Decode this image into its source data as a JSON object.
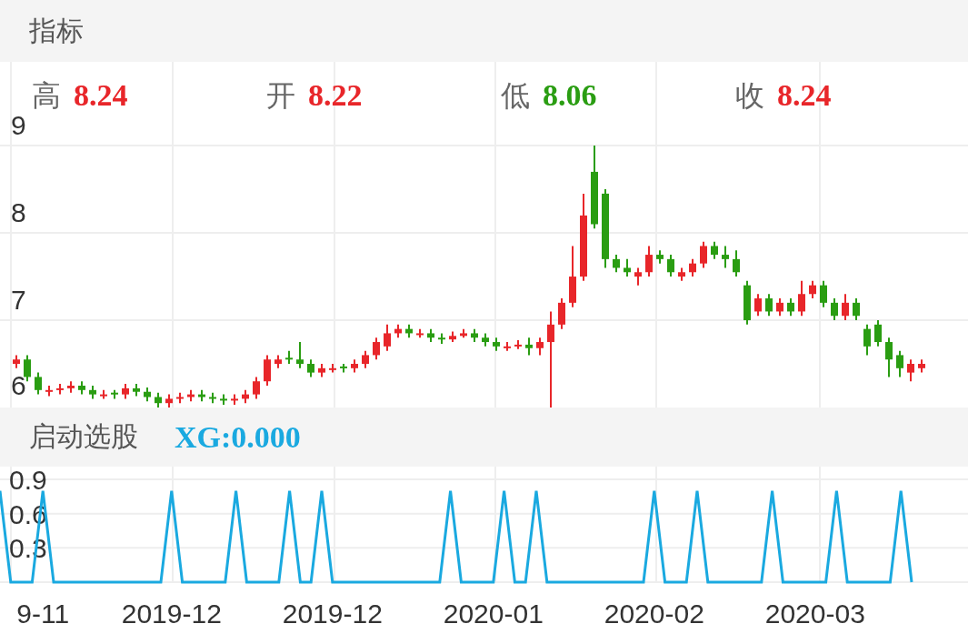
{
  "header": {
    "title": "指标"
  },
  "quote": [
    {
      "label": "高",
      "value": "8.24",
      "color": "#e8262a"
    },
    {
      "label": "开",
      "value": "8.22",
      "color": "#e8262a"
    },
    {
      "label": "低",
      "value": "8.06",
      "color": "#2a9d12"
    },
    {
      "label": "收",
      "value": "8.24",
      "color": "#e8262a"
    }
  ],
  "price_chart": {
    "chart_data": {
      "type": "candlestick",
      "ylim": [
        6,
        9.96
      ],
      "yticks": [
        6,
        7,
        8,
        9
      ],
      "grid": true,
      "categories": [
        null,
        null,
        null,
        null,
        null,
        null,
        null,
        null,
        null,
        null,
        null,
        null,
        null,
        null,
        null,
        null,
        null,
        null,
        null,
        null,
        null,
        null,
        null,
        null,
        null,
        null,
        null,
        null,
        null,
        null,
        null,
        null,
        null,
        null,
        null,
        null,
        null,
        null,
        null,
        null,
        null,
        null,
        null,
        null,
        null,
        null,
        null,
        null,
        null,
        null,
        null,
        null,
        null,
        null,
        null,
        null,
        null,
        null,
        null,
        null,
        null,
        null,
        null,
        null,
        null,
        null,
        null,
        null,
        null,
        null,
        null,
        null,
        null,
        null,
        null,
        null,
        null,
        null,
        null,
        null,
        null,
        null,
        null,
        null
      ],
      "ohlc": [
        [
          6.5,
          6.6,
          6.45,
          6.55
        ],
        [
          6.55,
          6.6,
          6.3,
          6.35
        ],
        [
          6.35,
          6.4,
          6.15,
          6.2
        ],
        [
          6.18,
          6.25,
          6.13,
          6.2
        ],
        [
          6.2,
          6.27,
          6.15,
          6.22
        ],
        [
          6.22,
          6.3,
          6.17,
          6.25
        ],
        [
          6.25,
          6.3,
          6.15,
          6.2
        ],
        [
          6.2,
          6.25,
          6.1,
          6.15
        ],
        [
          6.13,
          6.2,
          6.1,
          6.15
        ],
        [
          6.17,
          6.2,
          6.1,
          6.15
        ],
        [
          6.15,
          6.27,
          6.1,
          6.22
        ],
        [
          6.22,
          6.27,
          6.13,
          6.18
        ],
        [
          6.18,
          6.23,
          6.07,
          6.12
        ],
        [
          6.12,
          6.17,
          6.0,
          6.05
        ],
        [
          6.05,
          6.15,
          6.0,
          6.1
        ],
        [
          6.1,
          6.17,
          6.05,
          6.12
        ],
        [
          6.12,
          6.2,
          6.07,
          6.15
        ],
        [
          6.15,
          6.2,
          6.07,
          6.12
        ],
        [
          6.12,
          6.17,
          6.05,
          6.1
        ],
        [
          6.1,
          6.15,
          6.03,
          6.08
        ],
        [
          6.08,
          6.15,
          6.03,
          6.1
        ],
        [
          6.1,
          6.2,
          6.05,
          6.15
        ],
        [
          6.15,
          6.35,
          6.1,
          6.3
        ],
        [
          6.3,
          6.6,
          6.25,
          6.55
        ],
        [
          6.5,
          6.6,
          6.45,
          6.55
        ],
        [
          6.57,
          6.65,
          6.5,
          6.55
        ],
        [
          6.55,
          6.75,
          6.45,
          6.5
        ],
        [
          6.5,
          6.55,
          6.35,
          6.4
        ],
        [
          6.4,
          6.5,
          6.35,
          6.45
        ],
        [
          6.43,
          6.5,
          6.4,
          6.45
        ],
        [
          6.47,
          6.5,
          6.4,
          6.45
        ],
        [
          6.45,
          6.55,
          6.4,
          6.5
        ],
        [
          6.5,
          6.65,
          6.45,
          6.6
        ],
        [
          6.6,
          6.8,
          6.55,
          6.75
        ],
        [
          6.7,
          6.95,
          6.65,
          6.85
        ],
        [
          6.85,
          6.95,
          6.8,
          6.9
        ],
        [
          6.9,
          6.95,
          6.8,
          6.85
        ],
        [
          6.83,
          6.9,
          6.8,
          6.85
        ],
        [
          6.85,
          6.9,
          6.75,
          6.8
        ],
        [
          6.8,
          6.85,
          6.73,
          6.78
        ],
        [
          6.78,
          6.87,
          6.75,
          6.82
        ],
        [
          6.82,
          6.9,
          6.8,
          6.85
        ],
        [
          6.85,
          6.9,
          6.75,
          6.8
        ],
        [
          6.8,
          6.85,
          6.7,
          6.75
        ],
        [
          6.75,
          6.8,
          6.65,
          6.7
        ],
        [
          6.68,
          6.75,
          6.65,
          6.7
        ],
        [
          6.7,
          6.77,
          6.67,
          6.72
        ],
        [
          6.72,
          6.8,
          6.6,
          6.68
        ],
        [
          6.68,
          6.8,
          6.6,
          6.75
        ],
        [
          6.75,
          7.1,
          6.0,
          6.95
        ],
        [
          6.95,
          7.25,
          6.9,
          7.2
        ],
        [
          7.2,
          7.85,
          7.15,
          7.5
        ],
        [
          7.5,
          8.45,
          7.45,
          8.2
        ],
        [
          8.7,
          9.0,
          8.05,
          8.1
        ],
        [
          8.45,
          8.5,
          7.6,
          7.7
        ],
        [
          7.7,
          7.75,
          7.55,
          7.6
        ],
        [
          7.6,
          7.7,
          7.5,
          7.55
        ],
        [
          7.5,
          7.6,
          7.4,
          7.55
        ],
        [
          7.55,
          7.85,
          7.5,
          7.75
        ],
        [
          7.75,
          7.8,
          7.65,
          7.7
        ],
        [
          7.7,
          7.75,
          7.5,
          7.55
        ],
        [
          7.5,
          7.6,
          7.45,
          7.55
        ],
        [
          7.55,
          7.7,
          7.5,
          7.65
        ],
        [
          7.65,
          7.9,
          7.6,
          7.85
        ],
        [
          7.85,
          7.9,
          7.7,
          7.75
        ],
        [
          7.75,
          7.85,
          7.6,
          7.7
        ],
        [
          7.7,
          7.8,
          7.5,
          7.55
        ],
        [
          7.4,
          7.45,
          6.95,
          7.0
        ],
        [
          7.1,
          7.3,
          7.05,
          7.25
        ],
        [
          7.25,
          7.3,
          7.05,
          7.1
        ],
        [
          7.1,
          7.25,
          7.05,
          7.2
        ],
        [
          7.2,
          7.25,
          7.05,
          7.1
        ],
        [
          7.1,
          7.45,
          7.05,
          7.3
        ],
        [
          7.3,
          7.45,
          7.25,
          7.4
        ],
        [
          7.4,
          7.45,
          7.15,
          7.2
        ],
        [
          7.2,
          7.25,
          7.0,
          7.05
        ],
        [
          7.05,
          7.3,
          7.0,
          7.2
        ],
        [
          7.2,
          7.25,
          7.0,
          7.05
        ],
        [
          6.9,
          6.95,
          6.6,
          6.7
        ],
        [
          6.95,
          7.0,
          6.7,
          6.75
        ],
        [
          6.75,
          6.8,
          6.35,
          6.55
        ],
        [
          6.6,
          6.65,
          6.35,
          6.45
        ],
        [
          6.4,
          6.55,
          6.3,
          6.5
        ],
        [
          6.45,
          6.55,
          6.4,
          6.5
        ]
      ]
    }
  },
  "indicator": {
    "title": "启动选股",
    "value": "XG:0.000",
    "chart_data": {
      "type": "line",
      "ylim": [
        0,
        0.9
      ],
      "yticks": [
        0.3,
        0.6,
        0.9
      ],
      "grid": true,
      "categories": [
        null,
        null,
        null,
        null,
        "9-11",
        null,
        null,
        null,
        null,
        null,
        null,
        null,
        null,
        null,
        null,
        null,
        "2019-12",
        null,
        null,
        null,
        null,
        null,
        null,
        null,
        null,
        null,
        null,
        null,
        null,
        null,
        null,
        "2019-12",
        null,
        null,
        null,
        null,
        null,
        null,
        null,
        null,
        null,
        null,
        null,
        null,
        null,
        null,
        "2020-01",
        null,
        null,
        null,
        null,
        null,
        null,
        null,
        null,
        null,
        null,
        null,
        null,
        null,
        null,
        "2020-02",
        null,
        null,
        null,
        null,
        null,
        null,
        null,
        null,
        null,
        null,
        null,
        null,
        null,
        null,
        "2020-03",
        null,
        null,
        null,
        null,
        null,
        null,
        null,
        null,
        null
      ],
      "series": [
        {
          "color": "#1aa9e0",
          "values": [
            0.8,
            0,
            0,
            0,
            0.8,
            0,
            0,
            0,
            0,
            0,
            0,
            0,
            0,
            0,
            0,
            0,
            0.8,
            0,
            0,
            0,
            0,
            0,
            0.8,
            0,
            0,
            0,
            0,
            0.8,
            0,
            0,
            0.8,
            0,
            0,
            0,
            0,
            0,
            0,
            0,
            0,
            0,
            0,
            0,
            0.8,
            0,
            0,
            0,
            0,
            0.8,
            0,
            0,
            0.8,
            0,
            0,
            0,
            0,
            0,
            0,
            0,
            0,
            0,
            0,
            0.8,
            0,
            0,
            0,
            0.8,
            0,
            0,
            0,
            0,
            0,
            0,
            0.8,
            0,
            0,
            0,
            0,
            0,
            0.8,
            0,
            0,
            0,
            0,
            0,
            0.8,
            0
          ]
        }
      ]
    }
  }
}
